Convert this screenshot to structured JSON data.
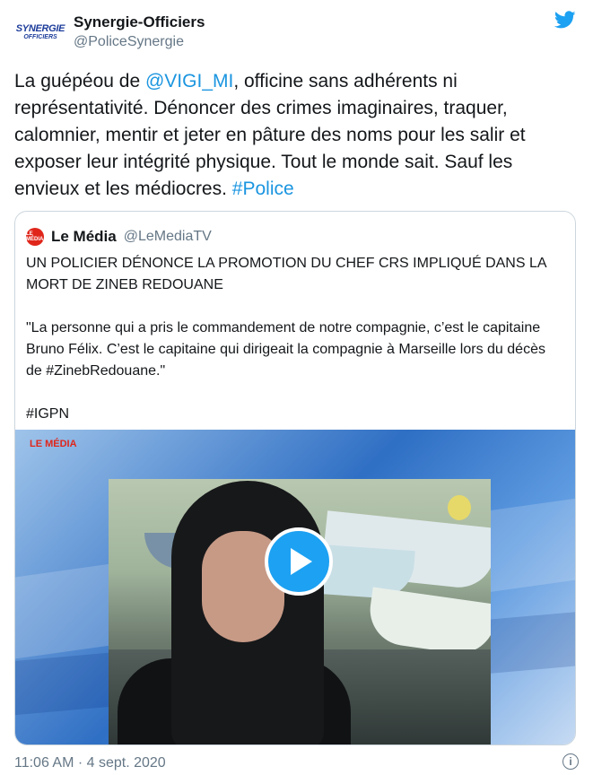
{
  "author": {
    "display_name": "Synergie-Officiers",
    "handle": "@PoliceSynergie",
    "avatar_text_1": "SYNERGIE",
    "avatar_text_2": "OFFICIERS"
  },
  "icons": {
    "brand": "twitter-bird-icon",
    "play": "play-icon",
    "info": "info-icon"
  },
  "tweet": {
    "t1": "La guépéou de ",
    "mention": "@VIGI_MI",
    "t2": ", officine sans adhérents ni représentativité. Dénoncer des crimes imaginaires, traquer, calomnier, mentir et jeter en pâture des noms pour les salir et exposer leur intégrité physique. Tout le monde sait. Sauf les envieux et les médiocres. ",
    "hashtag": "#Police"
  },
  "quoted": {
    "name": "Le Média",
    "handle": "@LeMediaTV",
    "headline": "UN POLICIER DÉNONCE LA PROMOTION DU CHEF CRS IMPLIQUÉ DANS LA MORT DE ZINEB REDOUANE",
    "quote": "\"La personne qui a pris le commandement de notre compagnie, c’est le capitaine Bruno Félix. C’est le capitaine qui dirigeait la compagnie à Marseille lors du décès de #ZinebRedouane.\"",
    "hashtag": "#IGPN"
  },
  "footer": {
    "timestamp": "11:06 AM · 4 sept. 2020",
    "info_glyph": "i"
  },
  "colors": {
    "link": "#1b95e0",
    "brand": "#1da1f2",
    "secondary": "#657786"
  }
}
